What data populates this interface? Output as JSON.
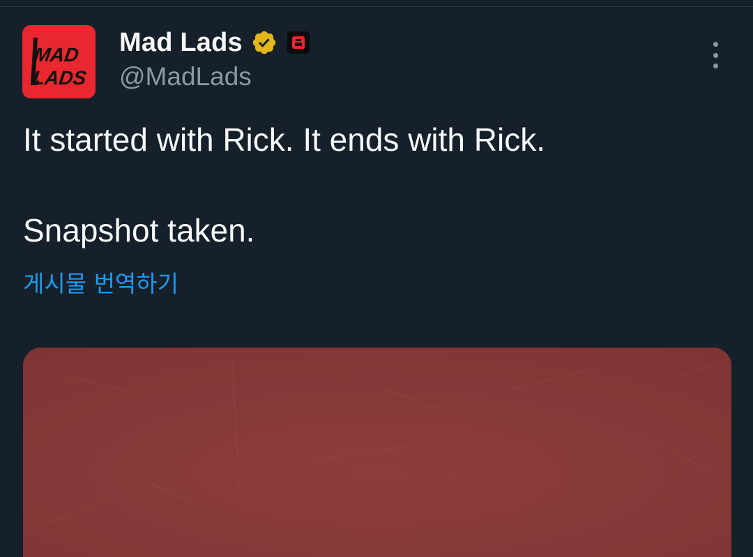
{
  "tweet": {
    "author": {
      "display_name": "Mad Lads",
      "handle": "@MadLads",
      "avatar_text_line1": "MAD",
      "avatar_text_line2": "LADS",
      "verified_badge": "gold-verified-icon",
      "affiliate_badge": "affiliate-icon"
    },
    "text_line1": "It started with Rick. It ends with Rick.",
    "text_line2": "Snapshot taken.",
    "translate_label": "게시물 번역하기",
    "media": {
      "type": "image",
      "dominant_color": "#8a3a3a"
    }
  },
  "colors": {
    "background": "#15202b",
    "primary_text": "#f7f9f9",
    "secondary_text": "#8b98a5",
    "link": "#1d9bf0",
    "verified_gold": "#e2b719",
    "avatar_red": "#e8272e"
  },
  "icons": {
    "more": "more-vertical-icon"
  }
}
